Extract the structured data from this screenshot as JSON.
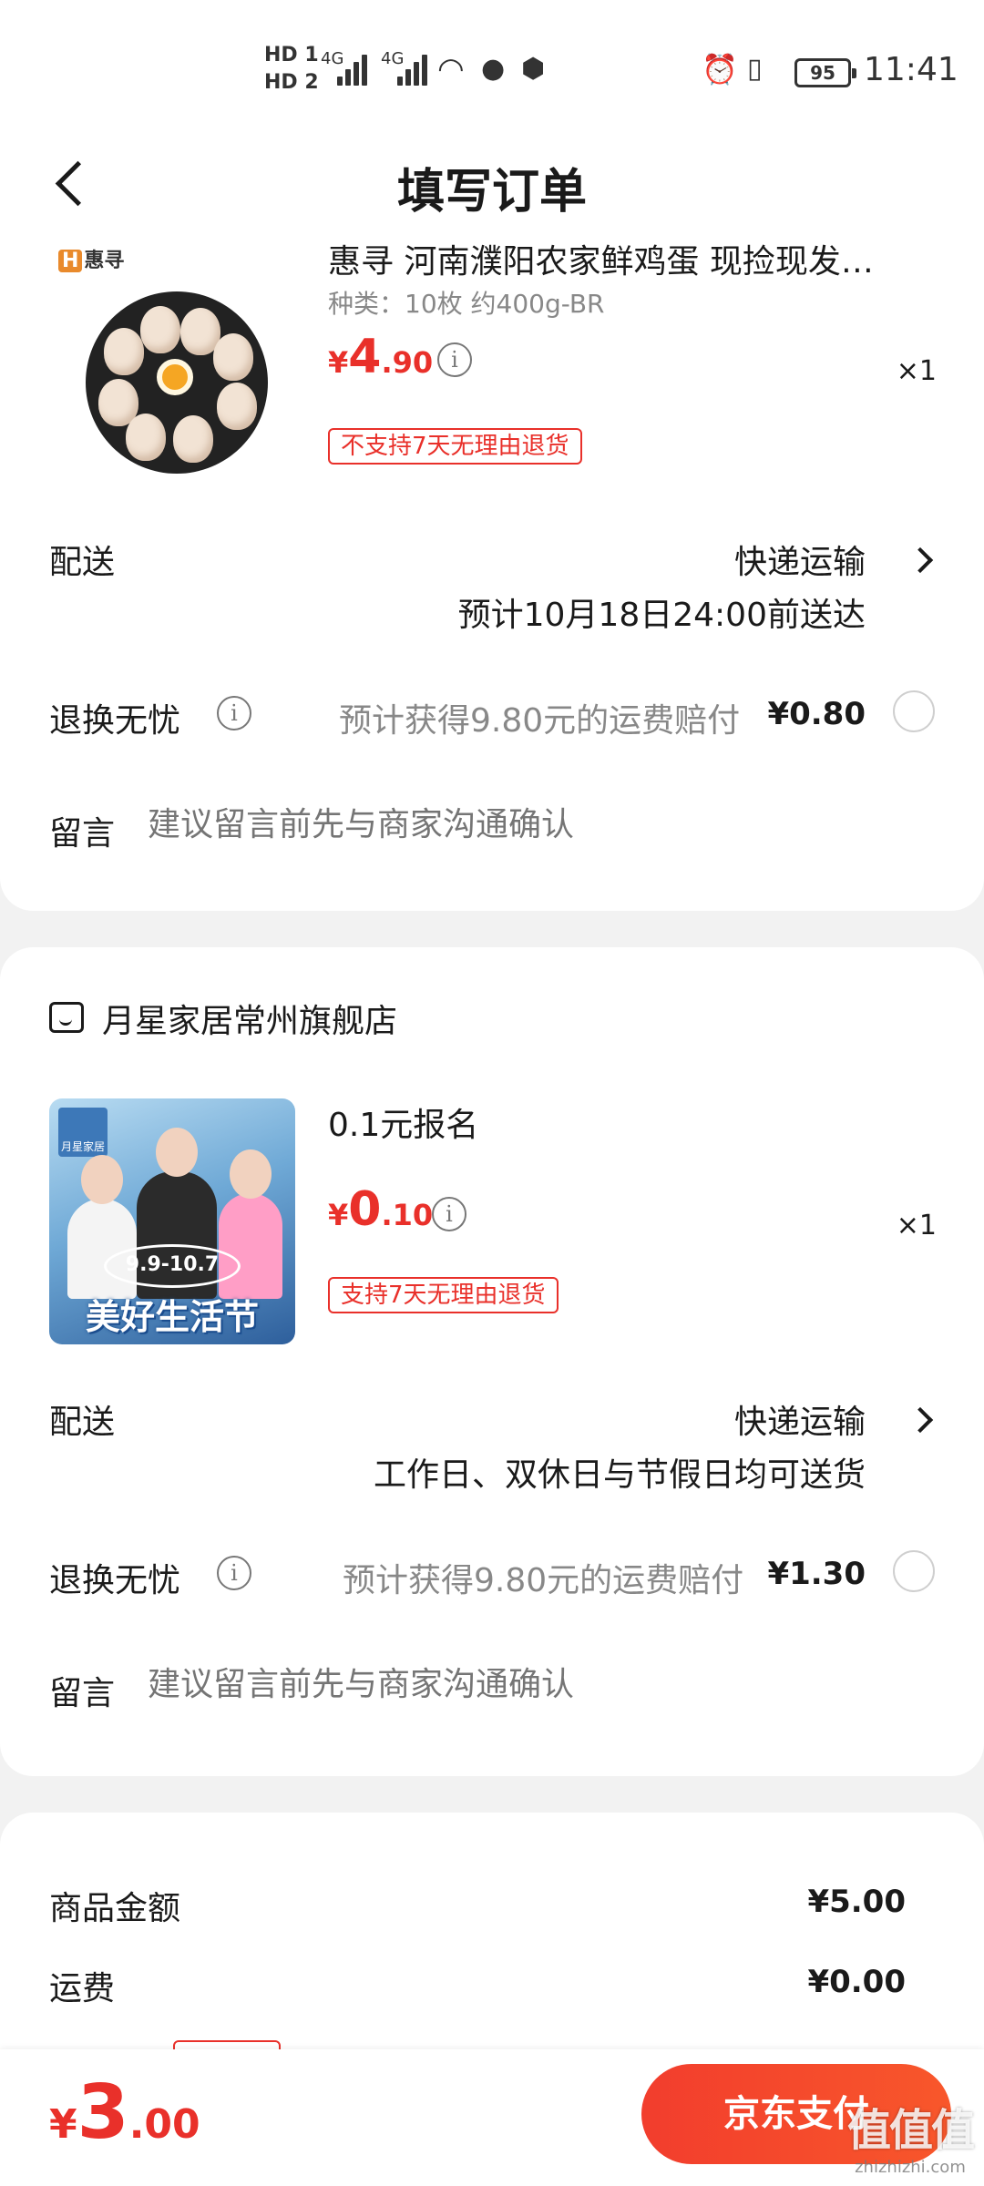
{
  "status_bar": {
    "hd1": "HD 1",
    "hd2": "HD 2",
    "net1": "4G",
    "net2": "4G",
    "battery": "95",
    "time": "11:41"
  },
  "header": {
    "title": "填写订单"
  },
  "order1": {
    "brand_logo": "惠寻",
    "product_title": "惠寻 河南濮阳农家鲜鸡蛋 现捡现发…",
    "spec": "种类：10枚  约400g-BR",
    "price_currency": "¥",
    "price_int": "4",
    "price_dec": ".90",
    "quantity": "×1",
    "return_tag": "不支持7天无理由退货",
    "delivery_label": "配送",
    "delivery_method": "快递运输",
    "delivery_eta": "预计10月18日24:00前送达",
    "worry_free_label": "退换无忧",
    "worry_free_hint": "预计获得9.80元的运费赔付",
    "worry_free_fee": "¥0.80",
    "note_label": "留言",
    "note_placeholder": "建议留言前先与商家沟通确认"
  },
  "order2": {
    "store_name": "月星家居常州旗舰店",
    "poster_logo": "月星家居",
    "poster_time": "9.9-10.7",
    "poster_title": "美好生活节",
    "product_title": "0.1元报名",
    "price_currency": "¥",
    "price_int": "0",
    "price_dec": ".10",
    "quantity": "×1",
    "return_tag": "支持7天无理由退货",
    "delivery_label": "配送",
    "delivery_method": "快递运输",
    "delivery_note": "工作日、双休日与节假日均可送货",
    "worry_free_label": "退换无忧",
    "worry_free_hint": "预计获得9.80元的运费赔付",
    "worry_free_fee": "¥1.30",
    "note_label": "留言",
    "note_placeholder": "建议留言前先与商家沟通确认"
  },
  "summary": {
    "goods_label": "商品金额",
    "goods_value": "¥5.00",
    "shipping_label": "运费",
    "shipping_value": "¥0.00"
  },
  "bottom_bar": {
    "total_currency": "¥",
    "total_int": "3",
    "total_dec": ".00",
    "pay_button": "京东支付",
    "watermark_main": "值值值",
    "watermark_sub": "zhizhizhi.com"
  },
  "colors": {
    "accent_red": "#e9302a",
    "pay_button": "#f23d2d",
    "page_bg": "#f2f2f2"
  }
}
